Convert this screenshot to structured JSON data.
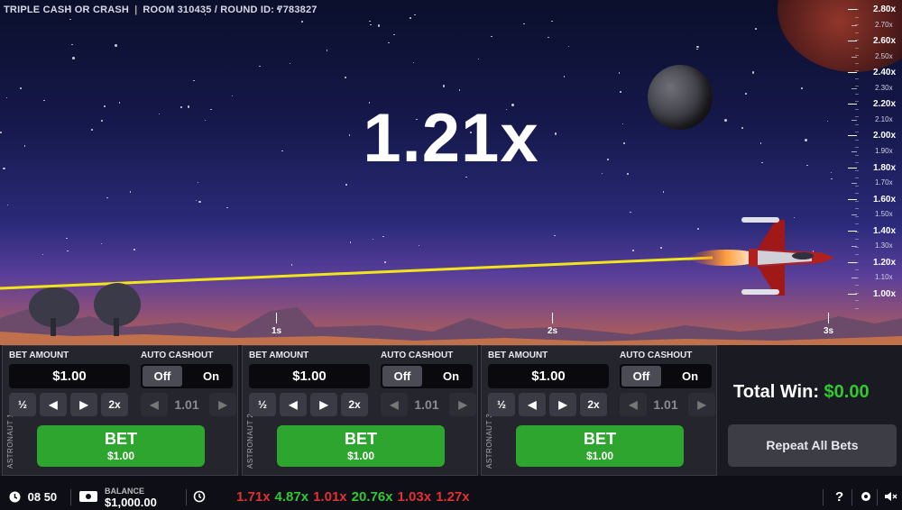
{
  "header": {
    "game_title": "TRIPLE CASH OR CRASH",
    "separator": "|",
    "room_round": "ROOM 310435 / ROUND ID: 7783827"
  },
  "multiplier": "1.21x",
  "ruler": {
    "major": [
      "2.80x",
      "2.60x",
      "2.40x",
      "2.20x",
      "2.00x",
      "1.80x",
      "1.60x",
      "1.40x",
      "1.20x",
      "1.00x"
    ],
    "minor": [
      "2.70x",
      "2.50x",
      "2.30x",
      "2.10x",
      "1.90x",
      "1.70x",
      "1.50x",
      "1.30x",
      "1.10x"
    ]
  },
  "time_axis": [
    "1s",
    "2s",
    "3s"
  ],
  "colors": {
    "win_green": "#32c832",
    "bet_green": "#2ea52e",
    "loss_red": "#e03030",
    "trail_yellow": "#f2e41a"
  },
  "panels": [
    {
      "astronaut": "ASTRONAUT 1",
      "bet_label": "BET AMOUNT",
      "auto_label": "AUTO CASHOUT",
      "amount": "$1.00",
      "off": "Off",
      "on": "On",
      "half": "½",
      "left": "◀",
      "right": "▶",
      "double": "2x",
      "auto_value": "1.01",
      "bet": "BET",
      "bet_amount": "$1.00"
    },
    {
      "astronaut": "ASTRONAUT 2",
      "bet_label": "BET AMOUNT",
      "auto_label": "AUTO CASHOUT",
      "amount": "$1.00",
      "off": "Off",
      "on": "On",
      "half": "½",
      "left": "◀",
      "right": "▶",
      "double": "2x",
      "auto_value": "1.01",
      "bet": "BET",
      "bet_amount": "$1.00"
    },
    {
      "astronaut": "ASTRONAUT 3",
      "bet_label": "BET AMOUNT",
      "auto_label": "AUTO CASHOUT",
      "amount": "$1.00",
      "off": "Off",
      "on": "On",
      "half": "½",
      "left": "◀",
      "right": "▶",
      "double": "2x",
      "auto_value": "1.01",
      "bet": "BET",
      "bet_amount": "$1.00"
    }
  ],
  "total_win": {
    "label": "Total Win:",
    "value": "$0.00"
  },
  "repeat_all_bets": "Repeat All Bets",
  "footer": {
    "time": "08 50",
    "balance_label": "BALANCE",
    "balance_value": "$1,000.00",
    "history": [
      {
        "value": "1.71x",
        "color": "red"
      },
      {
        "value": "4.87x",
        "color": "green"
      },
      {
        "value": "1.01x",
        "color": "red"
      },
      {
        "value": "20.76x",
        "color": "green"
      },
      {
        "value": "1.03x",
        "color": "red"
      },
      {
        "value": "1.27x",
        "color": "red"
      }
    ],
    "help": "?",
    "icons": [
      "clock-icon",
      "wallet-icon",
      "history-icon",
      "help-icon",
      "gear-icon",
      "mute-icon"
    ]
  }
}
